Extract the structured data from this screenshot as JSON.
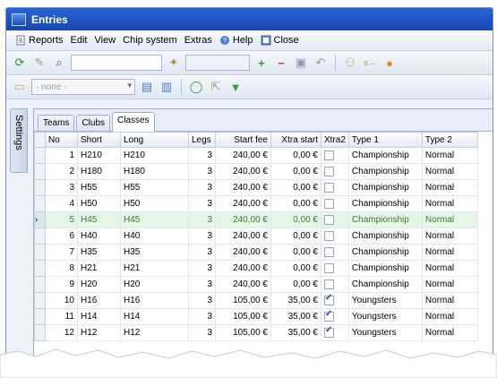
{
  "window": {
    "title": "Entries"
  },
  "menu": [
    {
      "label": "Reports",
      "icon": "report-icon"
    },
    {
      "label": "Edit",
      "icon": ""
    },
    {
      "label": "View",
      "icon": ""
    },
    {
      "label": "Chip system",
      "icon": ""
    },
    {
      "label": "Extras",
      "icon": ""
    },
    {
      "label": "Help",
      "icon": "help-icon"
    },
    {
      "label": "Close",
      "icon": "close-icon"
    }
  ],
  "toolbar2": {
    "filter_value": "- none -"
  },
  "side_tab": {
    "label": "Settings"
  },
  "tabs": [
    "Teams",
    "Clubs",
    "Classes"
  ],
  "active_tab": "Classes",
  "table": {
    "columns": [
      "No",
      "Short",
      "Long",
      "Legs",
      "Start fee",
      "Xtra start",
      "Xtra2",
      "Type 1",
      "Type 2"
    ],
    "rows": [
      {
        "no": "1",
        "short": "H210",
        "long": "H210",
        "legs": "3",
        "fee": "240,00 €",
        "xtra": "0,00 €",
        "xtra2": false,
        "type1": "Championship",
        "type2": "Normal"
      },
      {
        "no": "2",
        "short": "H180",
        "long": "H180",
        "legs": "3",
        "fee": "240,00 €",
        "xtra": "0,00 €",
        "xtra2": false,
        "type1": "Championship",
        "type2": "Normal"
      },
      {
        "no": "3",
        "short": "H55",
        "long": "H55",
        "legs": "3",
        "fee": "240,00 €",
        "xtra": "0,00 €",
        "xtra2": false,
        "type1": "Championship",
        "type2": "Normal"
      },
      {
        "no": "4",
        "short": "H50",
        "long": "H50",
        "legs": "3",
        "fee": "240,00 €",
        "xtra": "0,00 €",
        "xtra2": false,
        "type1": "Championship",
        "type2": "Normal"
      },
      {
        "no": "5",
        "short": "H45",
        "long": "H45",
        "legs": "3",
        "fee": "240,00 €",
        "xtra": "0,00 €",
        "xtra2": false,
        "type1": "Championship",
        "type2": "Normal",
        "selected": true
      },
      {
        "no": "6",
        "short": "H40",
        "long": "H40",
        "legs": "3",
        "fee": "240,00 €",
        "xtra": "0,00 €",
        "xtra2": false,
        "type1": "Championship",
        "type2": "Normal"
      },
      {
        "no": "7",
        "short": "H35",
        "long": "H35",
        "legs": "3",
        "fee": "240,00 €",
        "xtra": "0,00 €",
        "xtra2": false,
        "type1": "Championship",
        "type2": "Normal"
      },
      {
        "no": "8",
        "short": "H21",
        "long": "H21",
        "legs": "3",
        "fee": "240,00 €",
        "xtra": "0,00 €",
        "xtra2": false,
        "type1": "Championship",
        "type2": "Normal"
      },
      {
        "no": "9",
        "short": "H20",
        "long": "H20",
        "legs": "3",
        "fee": "240,00 €",
        "xtra": "0,00 €",
        "xtra2": false,
        "type1": "Championship",
        "type2": "Normal"
      },
      {
        "no": "10",
        "short": "H16",
        "long": "H16",
        "legs": "3",
        "fee": "105,00 €",
        "xtra": "35,00 €",
        "xtra2": true,
        "type1": "Youngsters",
        "type2": "Normal"
      },
      {
        "no": "11",
        "short": "H14",
        "long": "H14",
        "legs": "3",
        "fee": "105,00 €",
        "xtra": "35,00 €",
        "xtra2": true,
        "type1": "Youngsters",
        "type2": "Normal"
      },
      {
        "no": "12",
        "short": "H12",
        "long": "H12",
        "legs": "3",
        "fee": "105,00 €",
        "xtra": "35,00 €",
        "xtra2": true,
        "type1": "Youngsters",
        "type2": "Normal"
      }
    ]
  }
}
